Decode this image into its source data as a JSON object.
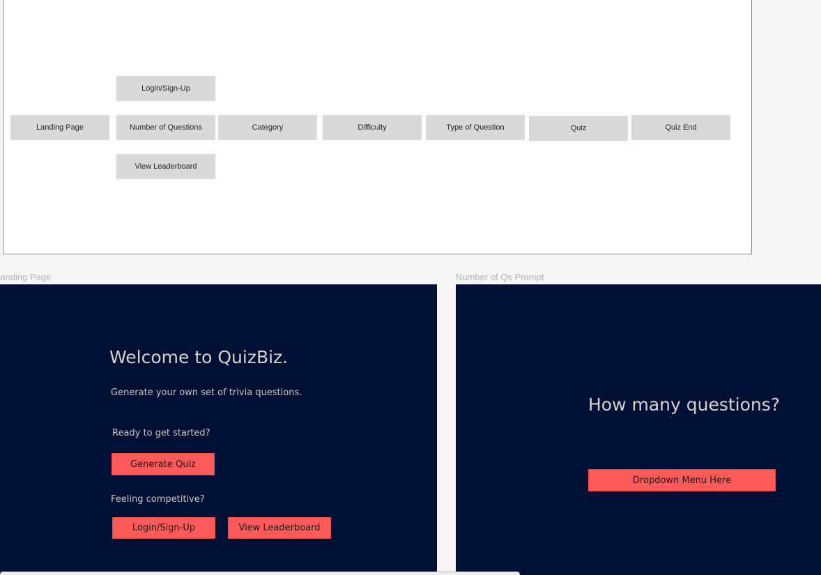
{
  "sitemap": {
    "nodes": {
      "landing_page": "Landing Page",
      "login_signup": "Login/Sign-Up",
      "number_of_questions": "Number of Questions",
      "view_leaderboard": "View Leaderboard",
      "category": "Category",
      "difficulty": "Difficulty",
      "type_of_question": "Type of Question",
      "quiz": "Quiz",
      "quiz_end": "Quiz End"
    }
  },
  "artboards": {
    "landing": {
      "label": "Landing Page",
      "title": "Welcome to QuizBiz.",
      "subtitle": "Generate your own set of trivia questions.",
      "ready_text": "Ready to get started?",
      "generate_button": "Generate Quiz",
      "competitive_text": "Feeling competitive?",
      "login_button": "Login/Sign-Up",
      "leaderboard_button": "View Leaderboard"
    },
    "number_prompt": {
      "label": "Number of Qs Prompt",
      "title": "How many questions?",
      "dropdown_button": "Dropdown Menu Here"
    }
  },
  "colors": {
    "artboard_bg": "#001035",
    "accent": "#ff5a5a",
    "node_bg": "#d9d9d9"
  }
}
